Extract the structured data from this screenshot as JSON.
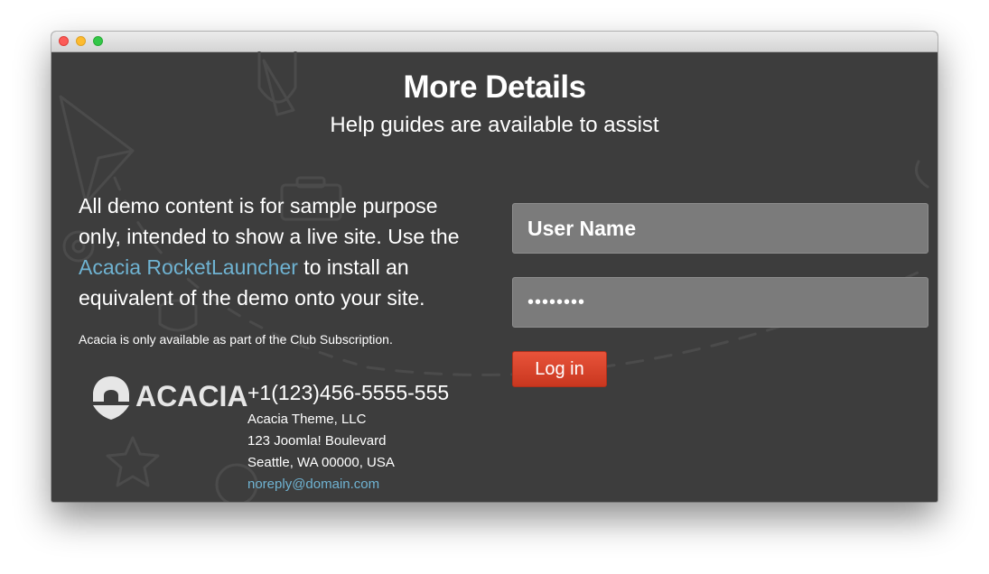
{
  "window": {
    "traffic_lights": [
      "close",
      "minimize",
      "zoom"
    ],
    "colors": {
      "background": "#3d3d3d",
      "accent": "#e14e34",
      "link": "#6fb3d2"
    }
  },
  "main": {
    "title": "More Details",
    "subtitle": "Help guides are available to assist",
    "intro_before": "All demo content is for sample purpose only, intended to show a live site. Use the ",
    "intro_link": "Acacia RocketLauncher",
    "intro_after": " to install an equivalent of the demo onto your site.",
    "note": "Acacia is only available as part of the Club Subscription."
  },
  "logo": {
    "text": "ACACIA",
    "icon": "acacia-shield-icon"
  },
  "contact": {
    "phone": "+1(123)456-5555-555",
    "company": "Acacia Theme, LLC",
    "street": "123 Joomla! Boulevard",
    "city": "Seattle, WA 00000, USA",
    "email": "noreply@domain.com"
  },
  "login": {
    "username_placeholder": "User Name",
    "password_value": "••••••••",
    "button_label": "Log in"
  }
}
